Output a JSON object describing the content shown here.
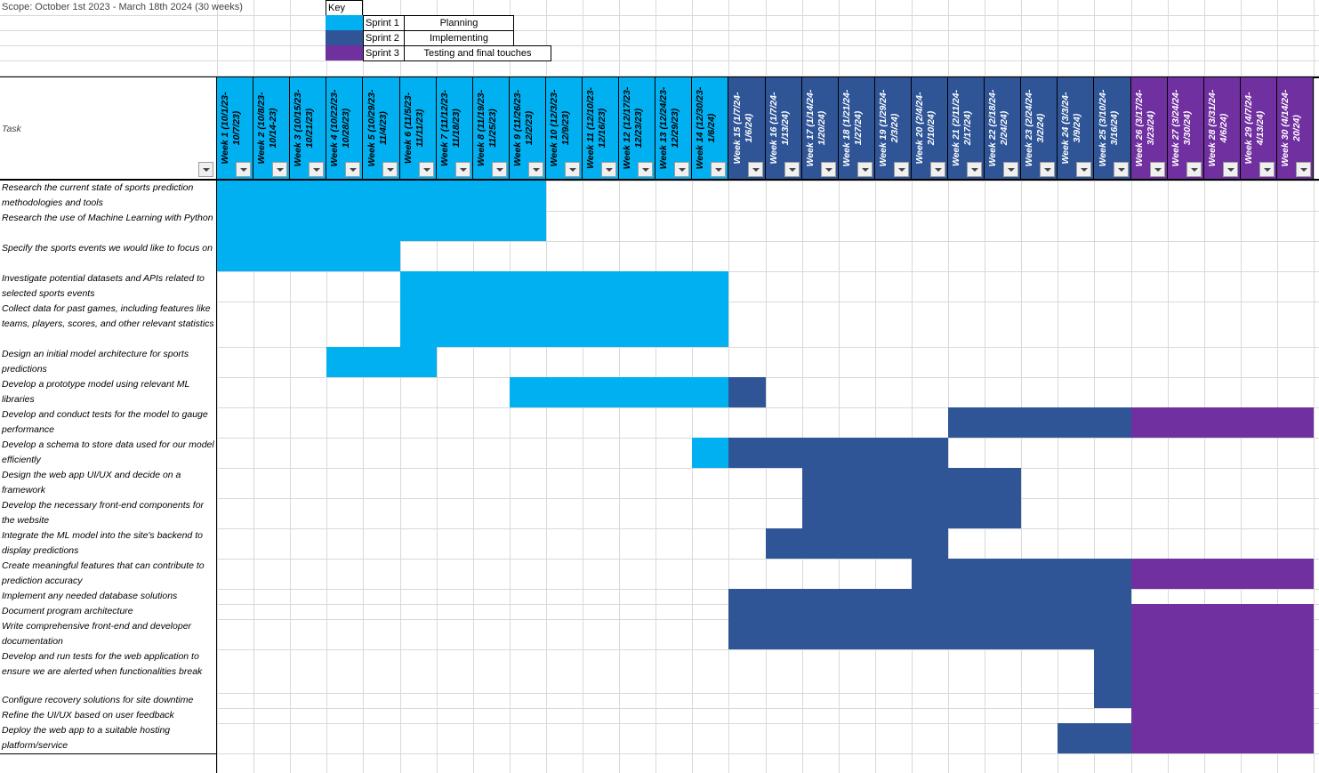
{
  "scope_text": "Scope: October 1st 2023 - March 18th 2024 (30 weeks)",
  "key": {
    "title": "Key",
    "items": [
      {
        "sprint": "Sprint 1",
        "meaning": "Planning",
        "color": "#00B0F0"
      },
      {
        "sprint": "Sprint 2",
        "meaning": "Implementing",
        "color": "#2F5597"
      },
      {
        "sprint": "Sprint 3",
        "meaning": "Testing and final touches",
        "color": "#7030A0"
      }
    ]
  },
  "task_header": "Task",
  "weeks": [
    "Week 1 (10/1/23-10/7/23)",
    "Week 2 (10/8/23-10/14-23)",
    "Week 3 (10/15/23-10/21/23)",
    "Week 4 (10/22/23-10/28/23)",
    "Week 5 (10/29/23-11/4/23)",
    "Week 6 (11/5/23-11/11/23)",
    "Week 7 (11/12/23-11/18/23)",
    "Week 8 (11/19/23-11/25/23)",
    "Week 9 (11/26/23-12/2/23)",
    "Week 10 (12/3/23-12/9/23)",
    "Week 11 (12/10/23-12/16/23)",
    "Week 12 (12/17/23-12/23/23)",
    "Week 13 (12/24/23-12/29/23)",
    "Week 14 (12/30/23-1/6/24)",
    "Week 15 (1/7/24-1/6/24)",
    "Week 16 (1/7/24-1/13/24)",
    "Week 17 (1/14/24-1/20/24)",
    "Week 18 (1/21/24-1/27/24)",
    "Week 19 (1/29/24-2/3/24)",
    "Week 20 (2/4/24-2/10/24)",
    "Week 21 (2/11/24-2/17/24)",
    "Week 22 (2/18/24-2/24/24)",
    "Week 23 (2/24/24-3/2/24)",
    "Week 24 (3/3/24-3/9/24)",
    "Week 25 (3/10/24-3/16/24)",
    "Week 26 (3/17/24-3/23/24)",
    "Week 27 (3/24/24-3/30/24)",
    "Week 28 (3/31/24-4/6/24)",
    "Week 29 (4/7/24-4/13/24)",
    "Week 30 (4/14/24-20/24)"
  ],
  "week_sprints": [
    1,
    1,
    1,
    1,
    1,
    1,
    1,
    1,
    1,
    1,
    1,
    1,
    1,
    1,
    2,
    2,
    2,
    2,
    2,
    2,
    2,
    2,
    2,
    2,
    2,
    3,
    3,
    3,
    3,
    3
  ],
  "tasks": [
    {
      "name": "Research the current state of sports prediction methodologies and tools",
      "segments": [
        {
          "start": 1,
          "end": 9,
          "sprint": 1
        }
      ]
    },
    {
      "name": "Research the use of Machine Learning with Python",
      "segments": [
        {
          "start": 1,
          "end": 9,
          "sprint": 1
        }
      ]
    },
    {
      "name": "Specify the sports events we would like to focus on",
      "segments": [
        {
          "start": 1,
          "end": 5,
          "sprint": 1
        }
      ]
    },
    {
      "name": "Investigate potential datasets and APIs related to selected sports events",
      "segments": [
        {
          "start": 6,
          "end": 14,
          "sprint": 1
        }
      ]
    },
    {
      "name": "Collect data for past games, including features like teams, players, scores, and other relevant statistics",
      "segments": [
        {
          "start": 6,
          "end": 14,
          "sprint": 1
        }
      ]
    },
    {
      "name": "Design an initial model architecture for sports predictions",
      "segments": [
        {
          "start": 4,
          "end": 6,
          "sprint": 1
        }
      ]
    },
    {
      "name": "Develop a prototype model using relevant ML libraries",
      "segments": [
        {
          "start": 9,
          "end": 14,
          "sprint": 1
        },
        {
          "start": 15,
          "end": 15,
          "sprint": 2
        }
      ]
    },
    {
      "name": "Develop and conduct tests for the model to gauge performance",
      "segments": [
        {
          "start": 21,
          "end": 25,
          "sprint": 2
        },
        {
          "start": 26,
          "end": 30,
          "sprint": 3
        }
      ]
    },
    {
      "name": "Develop a schema to store data used for our model efficiently",
      "segments": [
        {
          "start": 14,
          "end": 14,
          "sprint": 1
        },
        {
          "start": 15,
          "end": 20,
          "sprint": 2
        }
      ]
    },
    {
      "name": "Design the web app UI/UX and decide on a framework",
      "segments": [
        {
          "start": 17,
          "end": 22,
          "sprint": 2
        }
      ]
    },
    {
      "name": "Develop the necessary front-end components for the website",
      "segments": [
        {
          "start": 17,
          "end": 22,
          "sprint": 2
        }
      ]
    },
    {
      "name": "Integrate the ML model into the site's backend to display predictions",
      "segments": [
        {
          "start": 16,
          "end": 20,
          "sprint": 2
        }
      ]
    },
    {
      "name": "Create meaningful features that can contribute to prediction accuracy",
      "segments": [
        {
          "start": 20,
          "end": 25,
          "sprint": 2
        },
        {
          "start": 26,
          "end": 30,
          "sprint": 3
        }
      ]
    },
    {
      "name": "Implement any needed database solutions",
      "segments": [
        {
          "start": 15,
          "end": 25,
          "sprint": 2
        }
      ]
    },
    {
      "name": "Document program architecture",
      "segments": [
        {
          "start": 15,
          "end": 25,
          "sprint": 2
        },
        {
          "start": 26,
          "end": 30,
          "sprint": 3
        }
      ]
    },
    {
      "name": "Write comprehensive front-end and developer documentation",
      "segments": [
        {
          "start": 15,
          "end": 25,
          "sprint": 2
        },
        {
          "start": 26,
          "end": 30,
          "sprint": 3
        }
      ]
    },
    {
      "name": "Develop and run tests for the web application to ensure we are alerted when functionalities break",
      "segments": [
        {
          "start": 25,
          "end": 25,
          "sprint": 2
        },
        {
          "start": 26,
          "end": 30,
          "sprint": 3
        }
      ]
    },
    {
      "name": "Configure recovery solutions for site downtime",
      "segments": [
        {
          "start": 25,
          "end": 25,
          "sprint": 2
        },
        {
          "start": 26,
          "end": 30,
          "sprint": 3
        }
      ]
    },
    {
      "name": "Refine the UI/UX based on user feedback",
      "segments": [
        {
          "start": 26,
          "end": 30,
          "sprint": 3
        }
      ]
    },
    {
      "name": "Deploy the web app to a suitable hosting platform/service",
      "segments": [
        {
          "start": 24,
          "end": 25,
          "sprint": 2
        },
        {
          "start": 26,
          "end": 30,
          "sprint": 3
        }
      ]
    }
  ],
  "icons": {
    "filter": "dropdown-arrow-icon"
  }
}
